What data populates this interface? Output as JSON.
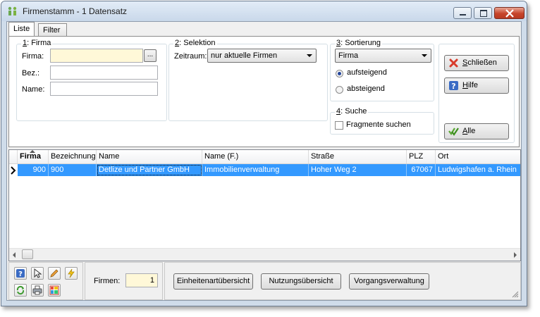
{
  "window": {
    "title": "Firmenstamm - 1 Datensatz",
    "minimize_icon": "minimize-icon",
    "maximize_icon": "maximize-icon",
    "close_icon": "close-icon"
  },
  "tabs": [
    {
      "label": "Liste",
      "active": true
    },
    {
      "label": "Filter",
      "active": false
    }
  ],
  "group_firma": {
    "title_num": "1",
    "title_rest": ": Firma",
    "firma_label": "Firma:",
    "firma_value": "",
    "browse_label": "...",
    "bez_label": "Bez.:",
    "bez_value": "",
    "name_label": "Name:",
    "name_value": ""
  },
  "group_selektion": {
    "title_num": "2",
    "title_rest": ": Selektion",
    "zeitraum_label": "Zeitraum:",
    "zeitraum_value": "nur aktuelle Firmen"
  },
  "group_sortierung": {
    "title_num": "3",
    "title_rest": ": Sortierung",
    "sort_value": "Firma",
    "asc_label": "aufsteigend",
    "asc_selected": true,
    "desc_label": "absteigend",
    "desc_selected": false
  },
  "group_suche": {
    "title_num": "4",
    "title_rest": ": Suche",
    "fragment_label": "Fragmente suchen",
    "fragment_checked": false
  },
  "side_buttons": {
    "close_u": "S",
    "close_rest": "chließen",
    "close_icon": "x-icon",
    "help_u": "H",
    "help_rest": "ilfe",
    "help_icon": "question-icon",
    "all_u": "A",
    "all_rest": "lle",
    "all_icon": "double-check-icon"
  },
  "grid": {
    "columns": [
      "Firma",
      "Bezeichnung",
      "Name",
      "Name (F.)",
      "Straße",
      "PLZ",
      "Ort"
    ],
    "sorted_column": "Firma",
    "rows": [
      {
        "firma": "900",
        "bezeichnung": "900",
        "name": "Detlize und Partner GmbH",
        "name_f": "Immobilienverwaltung",
        "strasse": "Hoher Weg 2",
        "plz": "67067",
        "ort": "Ludwigshafen a. Rhein",
        "selected": true
      }
    ]
  },
  "footer": {
    "tool_icons": [
      "question-icon",
      "cursor-icon",
      "pencil-icon",
      "lightning-icon",
      "refresh-icon",
      "printer-icon",
      "table-icon"
    ],
    "firmen_label": "Firmen:",
    "firmen_count": "1",
    "buttons": [
      "Einheitenartübersicht",
      "Nutzungsübersicht",
      "Vorgangsverwaltung"
    ]
  },
  "colors": {
    "selection": "#3399ff",
    "required_field": "#fff8d8",
    "close_button": "#c7452b"
  }
}
